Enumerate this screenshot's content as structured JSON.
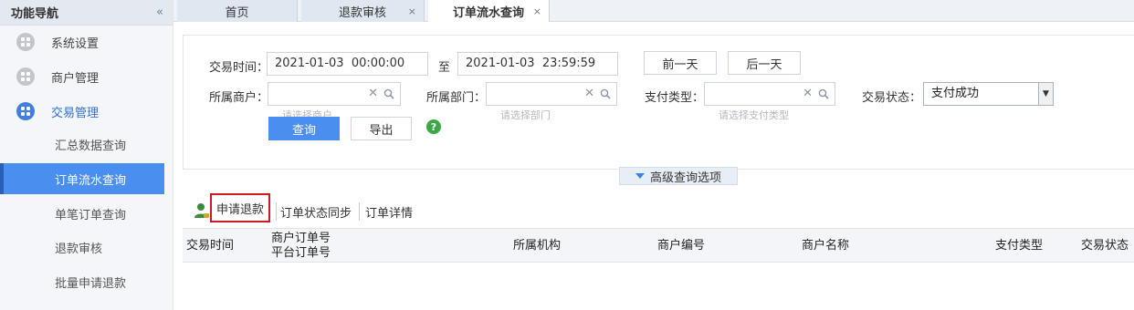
{
  "sidebar": {
    "title": "功能导航",
    "collapse_glyph": "«",
    "categories": [
      {
        "label": "系统设置",
        "icon": "grid-icon"
      },
      {
        "label": "商户管理",
        "icon": "grid-icon"
      },
      {
        "label": "交易管理",
        "icon": "grid-icon"
      }
    ],
    "sub_items": [
      {
        "label": "汇总数据查询"
      },
      {
        "label": "订单流水查询"
      },
      {
        "label": "单笔订单查询"
      },
      {
        "label": "退款审核"
      },
      {
        "label": "批量申请退款"
      }
    ]
  },
  "tabs": [
    {
      "label": "首页"
    },
    {
      "label": "退款审核",
      "close": "×"
    },
    {
      "label": "订单流水查询",
      "close": "×"
    }
  ],
  "search": {
    "time_label": "交易时间：",
    "time_start": "2021-01-03  00:00:00",
    "to_label": "至",
    "time_end": "2021-01-03  23:59:59",
    "prev_day": "前一天",
    "next_day": "后一天",
    "merchant_label": "所属商户：",
    "merchant_placeholder": "请选择商户",
    "dept_label": "所属部门：",
    "dept_placeholder": "请选择部门",
    "paytype_label": "支付类型：",
    "paytype_placeholder": "请选择支付类型",
    "status_label": "交易状态：",
    "status_value": "支付成功",
    "query_btn": "查询",
    "export_btn": "导出",
    "help_glyph": "?",
    "clear_glyph": "✕",
    "advanced": "高级查询选项"
  },
  "toolbar": {
    "apply_refund": "申请退款",
    "sync_status": "订单状态同步",
    "order_detail": "订单详情"
  },
  "table": {
    "headers": {
      "trade_time": "交易时间",
      "merchant_order_no": "商户订单号",
      "platform_order_no": "平台订单号",
      "org": "所属机构",
      "merchant_no": "商户编号",
      "merchant_name": "商户名称",
      "pay_type": "支付类型",
      "trade_status": "交易状态"
    }
  },
  "colors": {
    "accent": "#4a8ef0",
    "highlight_border": "#d0191f",
    "help_green": "#3aa847"
  }
}
